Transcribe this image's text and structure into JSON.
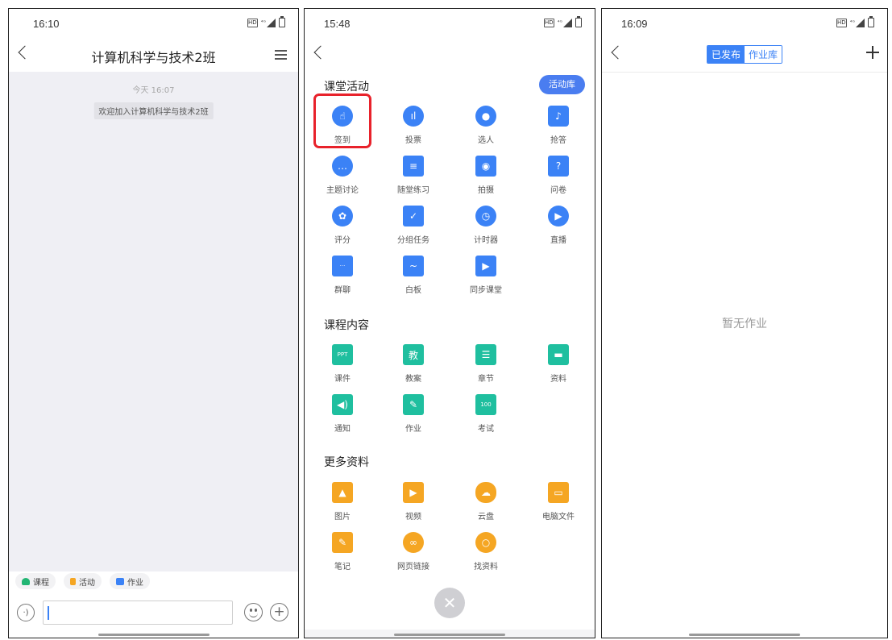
{
  "screen1": {
    "status_time": "16:10",
    "title": "计算机科学与技术2班",
    "chat_time": "今天 16:07",
    "system_message": "欢迎加入计算机科学与技术2班",
    "quick_actions": [
      {
        "label": "课程",
        "color": "#22b573"
      },
      {
        "label": "活动",
        "color": "#f5a623"
      },
      {
        "label": "作业",
        "color": "#3b82f6"
      }
    ]
  },
  "screen2": {
    "status_time": "15:48",
    "section_activity": "课堂活动",
    "activity_library_label": "活动库",
    "activities": [
      {
        "label": "签到",
        "icon": "hand-tap-icon",
        "color": "#3b82f6"
      },
      {
        "label": "投票",
        "icon": "bar-chart-icon",
        "color": "#3b82f6"
      },
      {
        "label": "选人",
        "icon": "person-check-icon",
        "color": "#3b82f6"
      },
      {
        "label": "抢答",
        "icon": "microphone-icon",
        "color": "#3b82f6"
      },
      {
        "label": "主题讨论",
        "icon": "chat-bubble-icon",
        "color": "#3b82f6"
      },
      {
        "label": "随堂练习",
        "icon": "exercise-doc-icon",
        "color": "#3b82f6"
      },
      {
        "label": "拍摄",
        "icon": "camera-icon",
        "color": "#3b82f6"
      },
      {
        "label": "问卷",
        "icon": "questionnaire-icon",
        "color": "#3b82f6"
      },
      {
        "label": "评分",
        "icon": "lotus-icon",
        "color": "#3b82f6"
      },
      {
        "label": "分组任务",
        "icon": "clipboard-check-icon",
        "color": "#3b82f6"
      },
      {
        "label": "计时器",
        "icon": "timer-icon",
        "color": "#3b82f6"
      },
      {
        "label": "直播",
        "icon": "play-icon",
        "color": "#3b82f6"
      },
      {
        "label": "群聊",
        "icon": "group-chat-icon",
        "color": "#3b82f6"
      },
      {
        "label": "白板",
        "icon": "whiteboard-icon",
        "color": "#3b82f6"
      },
      {
        "label": "同步课堂",
        "icon": "sync-class-icon",
        "color": "#3b82f6"
      }
    ],
    "section_content": "课程内容",
    "content_items": [
      {
        "label": "课件",
        "icon": "ppt-icon",
        "color": "#1fbf9f"
      },
      {
        "label": "教案",
        "icon": "lesson-plan-icon",
        "color": "#1fbf9f"
      },
      {
        "label": "章节",
        "icon": "chapter-list-icon",
        "color": "#1fbf9f"
      },
      {
        "label": "资料",
        "icon": "folder-icon",
        "color": "#1fbf9f"
      },
      {
        "label": "通知",
        "icon": "speaker-icon",
        "color": "#1fbf9f"
      },
      {
        "label": "作业",
        "icon": "homework-icon",
        "color": "#1fbf9f"
      },
      {
        "label": "考试",
        "icon": "exam-icon",
        "color": "#1fbf9f"
      }
    ],
    "section_more": "更多资料",
    "more_items": [
      {
        "label": "图片",
        "icon": "image-icon",
        "color": "#f5a623"
      },
      {
        "label": "视频",
        "icon": "video-icon",
        "color": "#f5a623"
      },
      {
        "label": "云盘",
        "icon": "cloud-icon",
        "color": "#f5a623"
      },
      {
        "label": "电脑文件",
        "icon": "monitor-icon",
        "color": "#f5a623"
      },
      {
        "label": "笔记",
        "icon": "note-icon",
        "color": "#f5a623"
      },
      {
        "label": "网页链接",
        "icon": "link-icon",
        "color": "#f5a623"
      },
      {
        "label": "找资料",
        "icon": "search-icon",
        "color": "#f5a623"
      }
    ]
  },
  "screen3": {
    "status_time": "16:09",
    "tab_published": "已发布",
    "tab_library": "作业库",
    "empty_text": "暂无作业"
  }
}
